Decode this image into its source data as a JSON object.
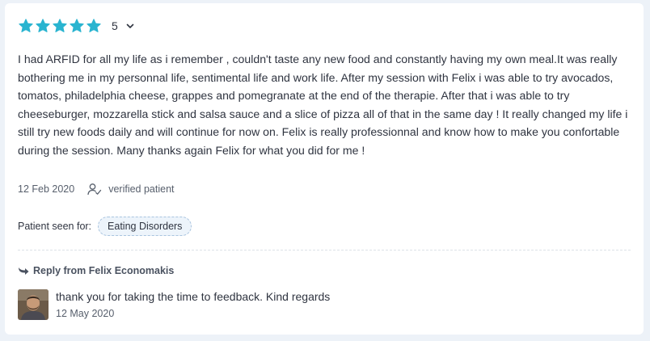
{
  "review": {
    "stars": 5,
    "star_color": "#2ab4d0",
    "score": "5",
    "text": "I had ARFID for all my life as i remember , couldn't taste any new food and constantly having my own meal.It was really bothering me in my personnal life, sentimental life and work life. After my session with Felix i was able to try avocados, tomatos, philadelphia cheese, grappes and pomegranate at the end of the therapie. After that i was able to try cheeseburger, mozzarella stick and salsa sauce and a slice of pizza all of that in the same day ! It really changed my life i still try new foods daily and will continue for now on. Felix is really professionnal and know how to make you confortable during the session. Many thanks again Felix for what you did for me !",
    "date": "12 Feb 2020",
    "verified_label": "verified patient",
    "seen_for_label": "Patient seen for:",
    "seen_for_badge": "Eating Disorders"
  },
  "reply": {
    "heading": "Reply from Felix Economakis",
    "text": "thank you for taking the time to feedback. Kind regards",
    "date": "12 May 2020"
  },
  "icons": {
    "star": "star-icon",
    "chevron": "chevron-down-icon",
    "verified": "user-check-icon",
    "reply": "reply-arrow-icon"
  }
}
